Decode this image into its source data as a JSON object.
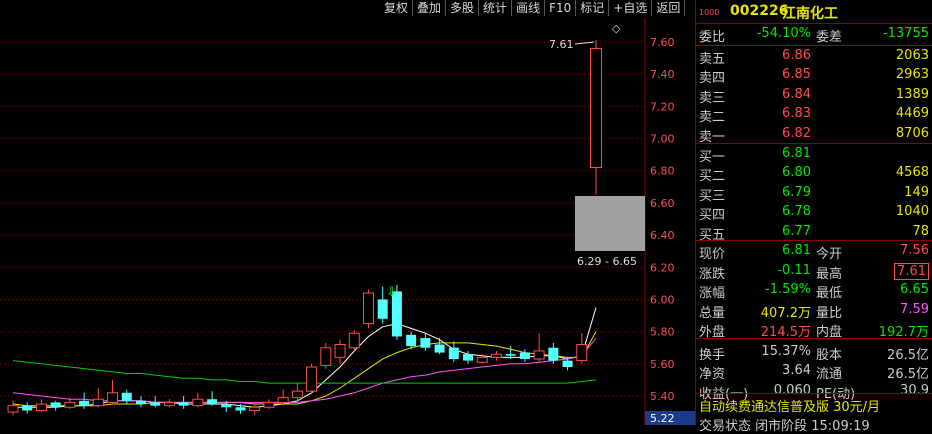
{
  "toolbar": {
    "items": [
      "复权",
      "叠加",
      "多股",
      "统计",
      "画线",
      "F10",
      "标记",
      "+自选",
      "返回"
    ]
  },
  "stock": {
    "badge": "1000",
    "code": "002226",
    "name": "江南化工"
  },
  "ratio": {
    "label": "委比",
    "value": "-54.10%",
    "diff_label": "委差",
    "diff_value": "-13755"
  },
  "asks": [
    {
      "label": "卖五",
      "price": "6.86",
      "vol": "2063"
    },
    {
      "label": "卖四",
      "price": "6.85",
      "vol": "2963"
    },
    {
      "label": "卖三",
      "price": "6.84",
      "vol": "1389"
    },
    {
      "label": "卖二",
      "price": "6.83",
      "vol": "4469"
    },
    {
      "label": "卖一",
      "price": "6.82",
      "vol": "8706"
    }
  ],
  "bids": [
    {
      "label": "买一",
      "price": "6.81",
      "vol": ""
    },
    {
      "label": "买二",
      "price": "6.80",
      "vol": "4568"
    },
    {
      "label": "买三",
      "price": "6.79",
      "vol": "149"
    },
    {
      "label": "买四",
      "price": "6.78",
      "vol": "1040"
    },
    {
      "label": "买五",
      "price": "6.77",
      "vol": "78"
    }
  ],
  "stats": [
    {
      "l1": "现价",
      "v1": "6.81",
      "c1": "green",
      "l2": "今开",
      "v2": "7.56",
      "c2": "red"
    },
    {
      "l1": "涨跌",
      "v1": "-0.11",
      "c1": "green",
      "l2": "最高",
      "v2": "7.61",
      "c2": "red",
      "boxed": true
    },
    {
      "l1": "涨幅",
      "v1": "-1.59%",
      "c1": "green",
      "l2": "最低",
      "v2": "6.65",
      "c2": "green"
    },
    {
      "l1": "总量",
      "v1": "407.2万",
      "c1": "yellow",
      "l2": "量比",
      "v2": "7.59",
      "c2": "pink"
    },
    {
      "l1": "外盘",
      "v1": "214.5万",
      "c1": "red",
      "l2": "内盘",
      "v2": "192.7万",
      "c2": "green"
    },
    {
      "l1": "换手",
      "v1": "15.37%",
      "c1": "white",
      "l2": "股本",
      "v2": "26.5亿",
      "c2": "white"
    },
    {
      "l1": "净资",
      "v1": "3.64",
      "c1": "white",
      "l2": "流通",
      "v2": "26.5亿",
      "c2": "white"
    },
    {
      "l1": "收益(一)",
      "v1": "0.060",
      "c1": "white",
      "l2": "PE(动)",
      "v2": "30.9",
      "c2": "white"
    }
  ],
  "ad": "自动续费通达信普及版 30元/月",
  "ad2": "交易状态 闭市阶段 15:09:19",
  "chart_data": {
    "type": "candlestick",
    "y_ticks": [
      "7.60",
      "7.40",
      "7.20",
      "7.00",
      "6.80",
      "6.60",
      "6.40",
      "6.20",
      "6.00",
      "5.80",
      "5.60",
      "5.40"
    ],
    "ylim": [
      5.35,
      7.7
    ],
    "high_label": "7.61",
    "range_label": "6.29 - 6.65",
    "cursor_value": "5.22",
    "candles": [
      {
        "o": 5.3,
        "c": 5.34,
        "h": 5.37,
        "l": 5.28
      },
      {
        "o": 5.34,
        "c": 5.31,
        "h": 5.36,
        "l": 5.29
      },
      {
        "o": 5.31,
        "c": 5.35,
        "h": 5.38,
        "l": 5.3
      },
      {
        "o": 5.36,
        "c": 5.33,
        "h": 5.37,
        "l": 5.31
      },
      {
        "o": 5.33,
        "c": 5.36,
        "h": 5.39,
        "l": 5.32
      },
      {
        "o": 5.37,
        "c": 5.34,
        "h": 5.42,
        "l": 5.32
      },
      {
        "o": 5.34,
        "c": 5.38,
        "h": 5.45,
        "l": 5.33
      },
      {
        "o": 5.36,
        "c": 5.42,
        "h": 5.5,
        "l": 5.35
      },
      {
        "o": 5.42,
        "c": 5.37,
        "h": 5.44,
        "l": 5.35
      },
      {
        "o": 5.37,
        "c": 5.35,
        "h": 5.4,
        "l": 5.33
      },
      {
        "o": 5.36,
        "c": 5.34,
        "h": 5.4,
        "l": 5.33
      },
      {
        "o": 5.34,
        "c": 5.36,
        "h": 5.38,
        "l": 5.33
      },
      {
        "o": 5.36,
        "c": 5.34,
        "h": 5.4,
        "l": 5.32
      },
      {
        "o": 5.34,
        "c": 5.38,
        "h": 5.42,
        "l": 5.33
      },
      {
        "o": 5.38,
        "c": 5.35,
        "h": 5.43,
        "l": 5.34
      },
      {
        "o": 5.35,
        "c": 5.33,
        "h": 5.37,
        "l": 5.3
      },
      {
        "o": 5.33,
        "c": 5.31,
        "h": 5.35,
        "l": 5.29
      },
      {
        "o": 5.31,
        "c": 5.33,
        "h": 5.35,
        "l": 5.28
      },
      {
        "o": 5.33,
        "c": 5.36,
        "h": 5.38,
        "l": 5.32
      },
      {
        "o": 5.36,
        "c": 5.39,
        "h": 5.44,
        "l": 5.34
      },
      {
        "o": 5.39,
        "c": 5.43,
        "h": 5.48,
        "l": 5.37
      },
      {
        "o": 5.43,
        "c": 5.58,
        "h": 5.6,
        "l": 5.41
      },
      {
        "o": 5.59,
        "c": 5.7,
        "h": 5.73,
        "l": 5.57
      },
      {
        "o": 5.64,
        "c": 5.72,
        "h": 5.75,
        "l": 5.6
      },
      {
        "o": 5.7,
        "c": 5.79,
        "h": 5.81,
        "l": 5.68
      },
      {
        "o": 5.85,
        "c": 6.04,
        "h": 6.06,
        "l": 5.82
      },
      {
        "o": 6.0,
        "c": 5.88,
        "h": 6.08,
        "l": 5.85
      },
      {
        "o": 6.05,
        "c": 5.77,
        "h": 6.09,
        "l": 5.75
      },
      {
        "o": 5.78,
        "c": 5.71,
        "h": 5.8,
        "l": 5.69
      },
      {
        "o": 5.76,
        "c": 5.7,
        "h": 5.79,
        "l": 5.68
      },
      {
        "o": 5.72,
        "c": 5.67,
        "h": 5.76,
        "l": 5.66
      },
      {
        "o": 5.7,
        "c": 5.63,
        "h": 5.74,
        "l": 5.61
      },
      {
        "o": 5.66,
        "c": 5.62,
        "h": 5.68,
        "l": 5.6
      },
      {
        "o": 5.61,
        "c": 5.64,
        "h": 5.66,
        "l": 5.6
      },
      {
        "o": 5.64,
        "c": 5.66,
        "h": 5.68,
        "l": 5.62
      },
      {
        "o": 5.66,
        "c": 5.65,
        "h": 5.71,
        "l": 5.63
      },
      {
        "o": 5.67,
        "c": 5.63,
        "h": 5.69,
        "l": 5.61
      },
      {
        "o": 5.63,
        "c": 5.68,
        "h": 5.79,
        "l": 5.61
      },
      {
        "o": 5.7,
        "c": 5.62,
        "h": 5.73,
        "l": 5.6
      },
      {
        "o": 5.62,
        "c": 5.58,
        "h": 5.64,
        "l": 5.56
      },
      {
        "o": 5.62,
        "c": 5.72,
        "h": 5.79,
        "l": 5.6
      },
      {
        "o": 6.82,
        "c": 7.56,
        "h": 7.61,
        "l": 6.65
      }
    ],
    "ma": [
      {
        "name": "MA5",
        "color": "#ffffff",
        "values": [
          5.33,
          5.33,
          5.33,
          5.33,
          5.34,
          5.34,
          5.35,
          5.37,
          5.37,
          5.37,
          5.36,
          5.36,
          5.35,
          5.35,
          5.35,
          5.35,
          5.34,
          5.33,
          5.34,
          5.35,
          5.37,
          5.42,
          5.5,
          5.58,
          5.68,
          5.77,
          5.83,
          5.85,
          5.82,
          5.79,
          5.75,
          5.69,
          5.66,
          5.65,
          5.64,
          5.64,
          5.64,
          5.65,
          5.65,
          5.63,
          5.65,
          5.95
        ]
      },
      {
        "name": "MA10",
        "color": "#e6e600",
        "values": [
          5.35,
          5.34,
          5.34,
          5.34,
          5.34,
          5.34,
          5.34,
          5.35,
          5.35,
          5.35,
          5.36,
          5.36,
          5.36,
          5.36,
          5.36,
          5.36,
          5.36,
          5.35,
          5.35,
          5.35,
          5.35,
          5.37,
          5.4,
          5.45,
          5.51,
          5.57,
          5.63,
          5.67,
          5.7,
          5.72,
          5.73,
          5.73,
          5.73,
          5.72,
          5.71,
          5.69,
          5.67,
          5.66,
          5.65,
          5.64,
          5.64,
          5.8
        ]
      },
      {
        "name": "MA20",
        "color": "#ff55ff",
        "values": [
          5.42,
          5.41,
          5.4,
          5.39,
          5.38,
          5.38,
          5.37,
          5.37,
          5.37,
          5.37,
          5.36,
          5.36,
          5.36,
          5.36,
          5.36,
          5.36,
          5.36,
          5.36,
          5.36,
          5.36,
          5.36,
          5.37,
          5.38,
          5.4,
          5.42,
          5.45,
          5.48,
          5.5,
          5.52,
          5.53,
          5.55,
          5.56,
          5.57,
          5.58,
          5.59,
          5.6,
          5.6,
          5.61,
          5.62,
          5.63,
          5.65,
          5.76
        ]
      },
      {
        "name": "MA60",
        "color": "#00cc00",
        "values": [
          5.62,
          5.61,
          5.6,
          5.59,
          5.58,
          5.57,
          5.56,
          5.55,
          5.54,
          5.54,
          5.53,
          5.52,
          5.51,
          5.51,
          5.5,
          5.5,
          5.49,
          5.49,
          5.48,
          5.48,
          5.48,
          5.48,
          5.48,
          5.48,
          5.48,
          5.48,
          5.48,
          5.48,
          5.48,
          5.48,
          5.48,
          5.48,
          5.48,
          5.48,
          5.48,
          5.48,
          5.48,
          5.48,
          5.48,
          5.48,
          5.49,
          5.5
        ]
      }
    ]
  }
}
